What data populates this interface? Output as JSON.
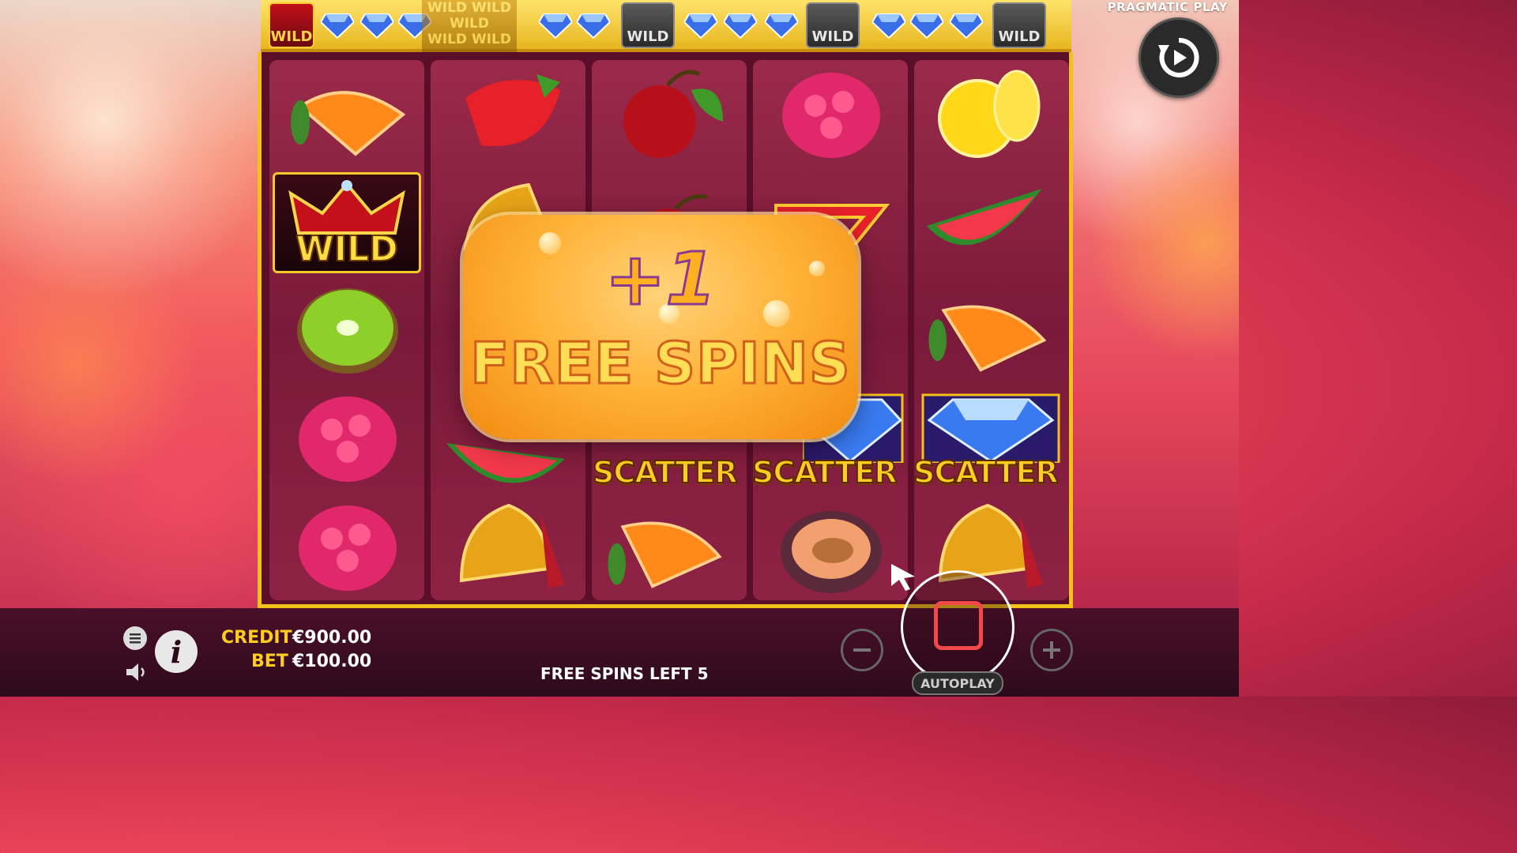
{
  "provider": "PRAGMATIC PLAY",
  "top_bar": {
    "wild_label": "WILD",
    "ghost_wild_labels": [
      "WILD WILD",
      "WILD",
      "WILD WILD"
    ]
  },
  "reels": {
    "wild_label": "WILD",
    "scatter_label": "SCATTER",
    "reel1": [
      "orange",
      "wild",
      "kiwi",
      "raspberry",
      "raspberry"
    ],
    "reel2": [
      "strawberry",
      "bell",
      "",
      "watermelon",
      "bell"
    ],
    "reel3": [
      "cherry",
      "cherry",
      "",
      "scatter",
      "orange"
    ],
    "reel4": [
      "raspberry",
      "seven",
      "",
      "scatter",
      "plum"
    ],
    "reel5": [
      "lemon",
      "watermelon",
      "orange",
      "scatter",
      "bell"
    ]
  },
  "popup": {
    "plus": "+1",
    "text": "FREE SPINS"
  },
  "bottom": {
    "credit_label": "CREDIT",
    "credit_value": "€900.00",
    "bet_label": "BET",
    "bet_value": "€100.00",
    "free_spins_left": "FREE SPINS LEFT 5",
    "autoplay": "AUTOPLAY",
    "info_glyph": "i"
  },
  "colors": {
    "frame_gold": "#f2c21a",
    "label_gold": "#ffcc22",
    "stop_red": "#f24a4a"
  }
}
